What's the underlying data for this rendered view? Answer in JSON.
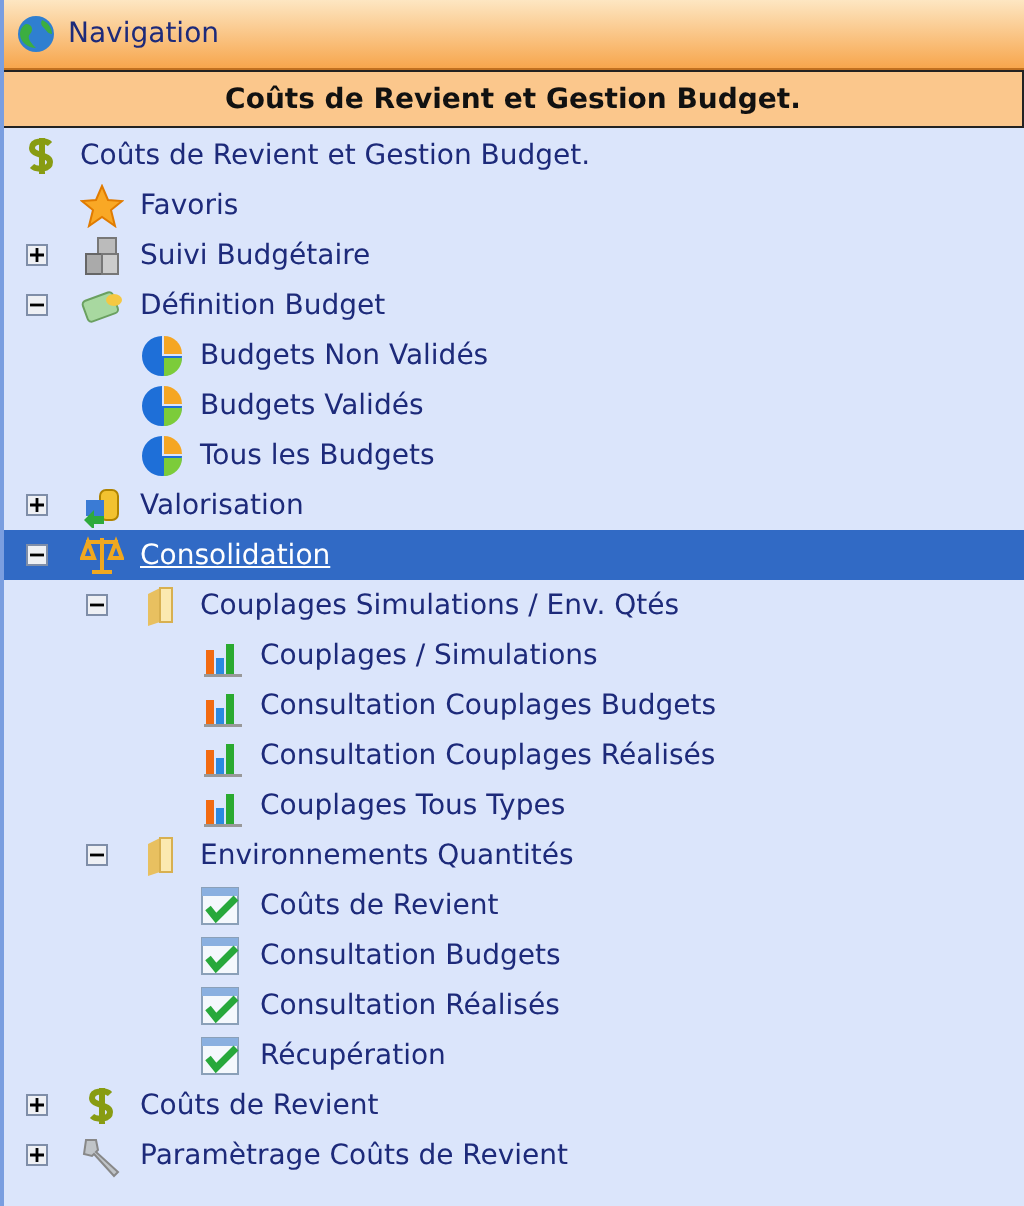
{
  "panel": {
    "title": "Navigation"
  },
  "subtitle": "Coûts de Revient et Gestion Budget.",
  "tree": [
    {
      "label": "Coûts de Revient et Gestion Budget.",
      "kind": "dollar",
      "selected": false,
      "children": [
        {
          "label": "Favoris",
          "kind": "star",
          "selected": false
        },
        {
          "label": "Suivi Budgétaire",
          "kind": "boxes",
          "expanded": false,
          "selected": false
        },
        {
          "label": "Définition Budget",
          "kind": "money",
          "expanded": true,
          "selected": false,
          "children": [
            {
              "label": "Budgets Non Validés",
              "kind": "pie",
              "selected": false
            },
            {
              "label": "Budgets Validés",
              "kind": "pie",
              "selected": false
            },
            {
              "label": "Tous les Budgets",
              "kind": "pie",
              "selected": false
            }
          ]
        },
        {
          "label": "Valorisation",
          "kind": "coins",
          "expanded": false,
          "selected": false
        },
        {
          "label": "Consolidation",
          "kind": "scale",
          "expanded": true,
          "selected": true,
          "children": [
            {
              "label": "Couplages Simulations / Env. Qtés",
              "kind": "folder",
              "expanded": true,
              "selected": false,
              "children": [
                {
                  "label": "Couplages / Simulations",
                  "kind": "chart",
                  "selected": false
                },
                {
                  "label": "Consultation Couplages Budgets",
                  "kind": "chart",
                  "selected": false
                },
                {
                  "label": "Consultation Couplages Réalisés",
                  "kind": "chart",
                  "selected": false
                },
                {
                  "label": "Couplages Tous Types",
                  "kind": "chart",
                  "selected": false
                }
              ]
            },
            {
              "label": "Environnements Quantités",
              "kind": "folder",
              "expanded": true,
              "selected": false,
              "children": [
                {
                  "label": "Coûts de Revient",
                  "kind": "check",
                  "selected": false
                },
                {
                  "label": "Consultation Budgets",
                  "kind": "check",
                  "selected": false
                },
                {
                  "label": "Consultation Réalisés",
                  "kind": "check",
                  "selected": false
                },
                {
                  "label": "Récupération",
                  "kind": "check",
                  "selected": false
                }
              ]
            }
          ]
        },
        {
          "label": "Coûts de Revient",
          "kind": "dollar",
          "expanded": false,
          "selected": false
        },
        {
          "label": "Paramètrage Coûts de Revient",
          "kind": "wrench",
          "expanded": false,
          "selected": false
        }
      ]
    }
  ]
}
